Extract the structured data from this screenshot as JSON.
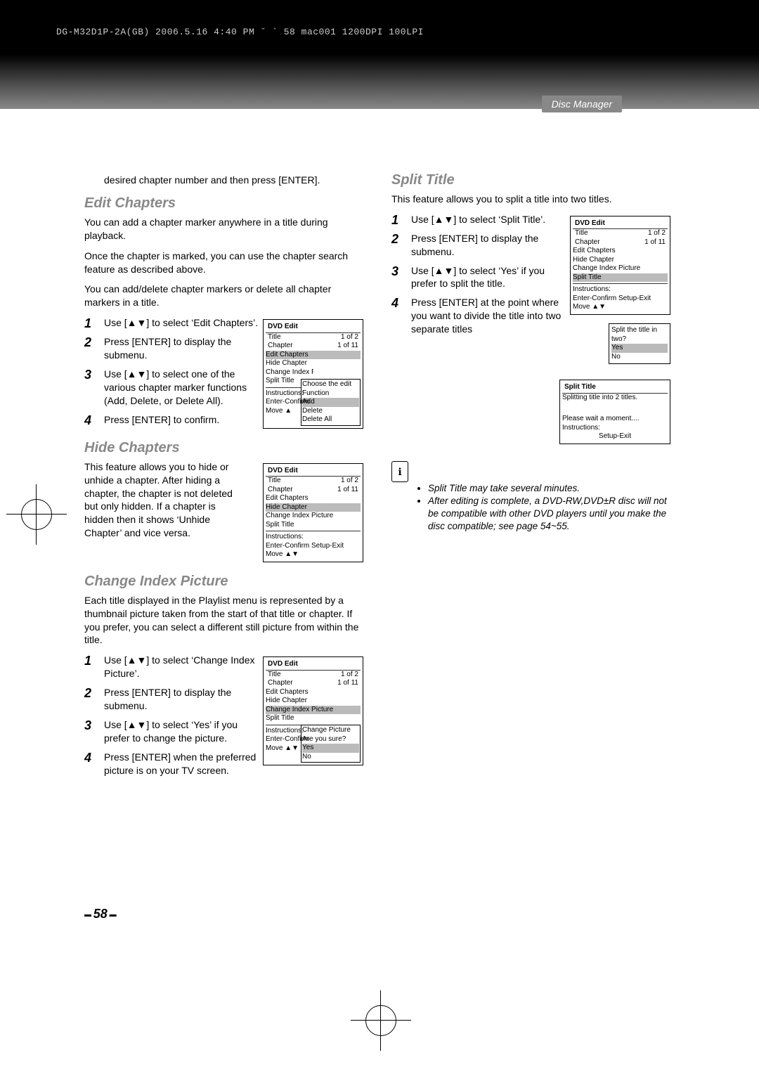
{
  "meta": {
    "printline": "DG-M32D1P-2A(GB)  2006.5.16 4:40 PM  ˘ ` 58   mac001  1200DPI 100LPI",
    "section_tab": "Disc Manager",
    "page_number": "58"
  },
  "intro_continued": "desired chapter number and then press [ENTER].",
  "editChapters": {
    "heading": "Edit Chapters",
    "p1": "You can add a chapter marker anywhere in a title during playback.",
    "p2": "Once the chapter is marked, you can use the chapter search feature as described above.",
    "p3": "You can add/delete chapter markers or delete all chapter markers in a title.",
    "steps": [
      "Use [▲▼] to select ‘Edit Chapters’.",
      "Press [ENTER] to display the submenu.",
      "Use [▲▼] to select one of the various chapter marker functions (Add, Delete, or Delete All).",
      "Press [ENTER] to confirm."
    ],
    "osd": {
      "title": "DVD Edit",
      "title_row": "Title",
      "title_val": "1 of 2",
      "chap_row": "Chapter",
      "chap_val": "1 of 11",
      "items": [
        "Edit Chapters",
        "Hide Chapter",
        "Change Index Picture",
        "Split Title"
      ],
      "instr1": "Instructions:",
      "instr2": "Enter-Confirm",
      "instr3": "Move ▲",
      "pop_title": "Choose the edit Function",
      "pop_items": [
        "Add",
        "Delete",
        "Delete All"
      ]
    }
  },
  "hideChapters": {
    "heading": "Hide Chapters",
    "p": "This feature allows you to hide or unhide a chapter. After hiding a chapter, the chapter is not deleted but only hidden. If a chapter is hidden then it shows ‘Unhide Chapter’ and vice versa.",
    "osd": {
      "title": "DVD Edit",
      "title_row": "Title",
      "title_val": "1 of 2",
      "chap_row": "Chapter",
      "chap_val": "1 of 11",
      "items": [
        "Edit Chapters",
        "Hide Chapter",
        "Change Index Picture",
        "Split Title"
      ],
      "instr1": "Instructions:",
      "instr2": "Enter-Confirm   Setup-Exit",
      "instr3": "Move ▲▼"
    }
  },
  "changeIndex": {
    "heading": "Change Index Picture",
    "p": "Each title displayed in the Playlist menu is represented by a thumbnail picture taken from the start of that title or chapter. If you prefer, you can select a different still picture from within the title.",
    "steps": [
      "Use [▲▼] to select ‘Change Index Picture’.",
      "Press [ENTER] to display the submenu.",
      "Use [▲▼] to select ‘Yes’ if you prefer to change the picture.",
      "Press [ENTER] when the preferred picture is on your TV screen."
    ],
    "osd": {
      "title": "DVD Edit",
      "title_row": "Title",
      "title_val": "1 of 2",
      "chap_row": "Chapter",
      "chap_val": "1 of 11",
      "items": [
        "Edit Chapters",
        "Hide Chapter",
        "Change Index Picture",
        "Split Title"
      ],
      "instr1": "Instructions:",
      "instr2": "Enter-Confirm",
      "instr3": "Move ▲▼",
      "pop_title": "Change Picture",
      "pop_q": "Are you sure?",
      "pop_yes": "Yes",
      "pop_no": "No"
    }
  },
  "splitTitle": {
    "heading": "Split Title",
    "p": "This feature allows you to split a title into two titles.",
    "steps": [
      "Use [▲▼] to select ‘Split Title’.",
      "Press [ENTER] to display the submenu.",
      "Use [▲▼] to select ‘Yes’ if you prefer to split the title.",
      "Press [ENTER] at the point where you want to divide the title into two separate titles"
    ],
    "osd1": {
      "title": "DVD Edit",
      "title_row": "Title",
      "title_val": "1 of 2",
      "chap_row": "Chapter",
      "chap_val": "1 of 11",
      "items": [
        "Edit Chapters",
        "Hide Chapter",
        "Change Index Picture",
        "Split Title"
      ],
      "instr1": "Instructions:",
      "instr2": "Enter-Confirm   Setup-Exit",
      "instr3": "Move ▲▼"
    },
    "osd2": {
      "q": "Split the title in two?",
      "yes": "Yes",
      "no": "No"
    },
    "osd3": {
      "title": "Split Title",
      "line1": "Splitting title into 2 titles.",
      "line2": "Please wait a moment....",
      "line3": "Instructions:",
      "line4": "Setup-Exit"
    },
    "notes": [
      "Split Title may take several minutes.",
      "After editing is complete, a DVD-RW,DVD±R disc will not be compatible with other DVD players until you make the disc compatible; see page 54~55."
    ]
  }
}
